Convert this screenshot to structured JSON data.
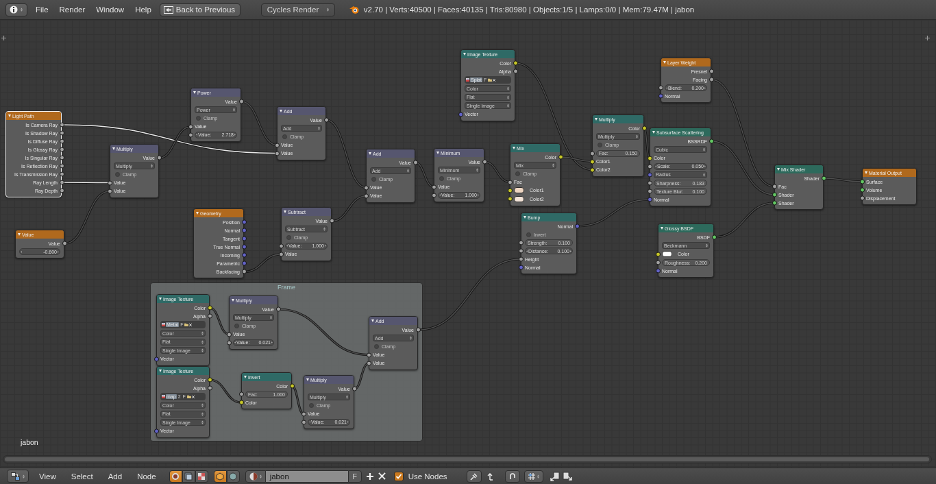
{
  "top_bar": {
    "menus": [
      "File",
      "Render",
      "Window",
      "Help"
    ],
    "back_button": "Back to Previous",
    "render_engine": "Cycles Render",
    "stats": "v2.70 | Verts:40500 | Faces:40135 | Tris:80980 | Objects:1/5 | Lamps:0/0 | Mem:79.47M | jabon"
  },
  "nodes": [
    {
      "title": "Light Path",
      "kind": "input",
      "selected": true,
      "rows": [
        {
          "kind": "output",
          "label": "Is Camera Ray",
          "socket": {
            "kind": "value"
          }
        },
        {
          "kind": "output",
          "label": "Is Shadow Ray",
          "socket": {
            "kind": "value"
          }
        },
        {
          "kind": "output",
          "label": "Is Diffuse Ray",
          "socket": {
            "kind": "value"
          }
        },
        {
          "kind": "output",
          "label": "Is Glossy Ray",
          "socket": {
            "kind": "value"
          }
        },
        {
          "kind": "output",
          "label": "Is Singular Ray",
          "socket": {
            "kind": "value"
          }
        },
        {
          "kind": "output",
          "label": "Is Reflection Ray",
          "socket": {
            "kind": "value"
          }
        },
        {
          "kind": "output",
          "label": "Is Transmission Ray",
          "socket": {
            "kind": "value"
          }
        },
        {
          "kind": "output",
          "label": "Ray Length",
          "socket": {
            "kind": "value"
          }
        },
        {
          "kind": "output",
          "label": "Ray Depth",
          "socket": {
            "kind": "value"
          }
        }
      ]
    },
    {
      "title": "Value",
      "kind": "input",
      "selected": false,
      "rows": [
        {
          "kind": "output",
          "label": "Value",
          "socket": {
            "kind": "value"
          }
        },
        {
          "kind": "number",
          "value": "-0.600"
        }
      ]
    },
    {
      "title": "Multiply",
      "kind": "converter",
      "selected": false,
      "rows": [
        {
          "kind": "output",
          "label": "Value",
          "socket": {
            "kind": "value"
          }
        },
        {
          "kind": "dropdown",
          "value": "Multiply"
        },
        {
          "kind": "checkbox",
          "label": "Clamp",
          "checked": false
        },
        {
          "kind": "input",
          "label": "Value",
          "socket": {
            "kind": "value"
          }
        },
        {
          "kind": "input",
          "label": "Value",
          "socket": {
            "kind": "value"
          }
        }
      ]
    },
    {
      "title": "Power",
      "kind": "converter",
      "selected": false,
      "rows": [
        {
          "kind": "output",
          "label": "Value",
          "socket": {
            "kind": "value"
          }
        },
        {
          "kind": "dropdown",
          "value": "Power"
        },
        {
          "kind": "checkbox",
          "label": "Clamp",
          "checked": false
        },
        {
          "kind": "input",
          "label": "Value",
          "socket": {
            "kind": "value"
          }
        },
        {
          "kind": "number",
          "label": "Value:",
          "value": "2.718",
          "socket": {
            "kind": "value"
          }
        }
      ]
    },
    {
      "title": "Add",
      "kind": "converter",
      "selected": false,
      "rows": [
        {
          "kind": "output",
          "label": "Value",
          "socket": {
            "kind": "value"
          }
        },
        {
          "kind": "dropdown",
          "value": "Add"
        },
        {
          "kind": "checkbox",
          "label": "Clamp",
          "checked": false
        },
        {
          "kind": "input",
          "label": "Value",
          "socket": {
            "kind": "value"
          }
        },
        {
          "kind": "input",
          "label": "Value",
          "socket": {
            "kind": "value"
          }
        }
      ]
    },
    {
      "title": "Geometry",
      "kind": "input",
      "selected": false,
      "rows": [
        {
          "kind": "output",
          "label": "Position",
          "socket": {
            "kind": "vector"
          }
        },
        {
          "kind": "output",
          "label": "Normal",
          "socket": {
            "kind": "vector"
          }
        },
        {
          "kind": "output",
          "label": "Tangent",
          "socket": {
            "kind": "vector"
          }
        },
        {
          "kind": "output",
          "label": "True Normal",
          "socket": {
            "kind": "vector"
          }
        },
        {
          "kind": "output",
          "label": "Incoming",
          "socket": {
            "kind": "vector"
          }
        },
        {
          "kind": "output",
          "label": "Parametric",
          "socket": {
            "kind": "vector"
          }
        },
        {
          "kind": "output",
          "label": "Backfacing",
          "socket": {
            "kind": "value"
          }
        }
      ]
    },
    {
      "title": "Subtract",
      "kind": "converter",
      "selected": false,
      "rows": [
        {
          "kind": "output",
          "label": "Value",
          "socket": {
            "kind": "value"
          }
        },
        {
          "kind": "dropdown",
          "value": "Subtract"
        },
        {
          "kind": "checkbox",
          "label": "Clamp",
          "checked": false
        },
        {
          "kind": "number",
          "label": "Value:",
          "value": "1.000",
          "socket": {
            "kind": "value"
          }
        },
        {
          "kind": "input",
          "label": "Value",
          "socket": {
            "kind": "value"
          }
        }
      ]
    },
    {
      "title": "Add",
      "kind": "converter",
      "selected": false,
      "rows": [
        {
          "kind": "output",
          "label": "Value",
          "socket": {
            "kind": "value"
          }
        },
        {
          "kind": "dropdown",
          "value": "Add"
        },
        {
          "kind": "checkbox",
          "label": "Clamp",
          "checked": false
        },
        {
          "kind": "input",
          "label": "Value",
          "socket": {
            "kind": "value"
          }
        },
        {
          "kind": "input",
          "label": "Value",
          "socket": {
            "kind": "value"
          }
        }
      ]
    },
    {
      "title": "Minimum",
      "kind": "converter",
      "selected": false,
      "rows": [
        {
          "kind": "output",
          "label": "Value",
          "socket": {
            "kind": "value"
          }
        },
        {
          "kind": "dropdown",
          "value": "Minimum"
        },
        {
          "kind": "checkbox",
          "label": "Clamp",
          "checked": false
        },
        {
          "kind": "input",
          "label": "Value",
          "socket": {
            "kind": "value"
          }
        },
        {
          "kind": "number",
          "label": "Value:",
          "value": "1.000",
          "socket": {
            "kind": "value"
          }
        }
      ]
    },
    {
      "title": "Mix",
      "kind": "color",
      "selected": false,
      "rows": [
        {
          "kind": "output",
          "label": "Color",
          "socket": {
            "kind": "color"
          }
        },
        {
          "kind": "dropdown",
          "value": "Mix"
        },
        {
          "kind": "checkbox",
          "label": "Clamp",
          "checked": false
        },
        {
          "kind": "input",
          "label": "Fac",
          "socket": {
            "kind": "value"
          }
        },
        {
          "kind": "color",
          "label": "Color1",
          "socket": {
            "kind": "color"
          },
          "color": "#efd6c2"
        },
        {
          "kind": "color",
          "label": "Color2",
          "socket": {
            "kind": "color"
          },
          "color": "#f3e4d8"
        }
      ]
    },
    {
      "title": "Image Texture",
      "kind": "texture",
      "selected": false,
      "rows": [
        {
          "kind": "output",
          "label": "Color",
          "socket": {
            "kind": "color"
          }
        },
        {
          "kind": "output",
          "label": "Alpha",
          "socket": {
            "kind": "value"
          }
        },
        {
          "kind": "image",
          "name": "Splat",
          "extras": [
            "F"
          ]
        },
        {
          "kind": "dropdown",
          "value": "Color"
        },
        {
          "kind": "dropdown",
          "value": "Flat"
        },
        {
          "kind": "dropdown",
          "value": "Single Image"
        },
        {
          "kind": "input",
          "label": "Vector",
          "socket": {
            "kind": "vector"
          }
        }
      ]
    },
    {
      "title": "Bump",
      "kind": "vector",
      "selected": false,
      "rows": [
        {
          "kind": "output",
          "label": "Normal",
          "socket": {
            "kind": "vector"
          }
        },
        {
          "kind": "checkbox",
          "label": "Invert",
          "checked": false
        },
        {
          "kind": "slider",
          "label": "Strength:",
          "value": "0.100",
          "socket": {
            "kind": "value"
          }
        },
        {
          "kind": "number",
          "label": "Distance:",
          "value": "0.100",
          "socket": {
            "kind": "value"
          }
        },
        {
          "kind": "input",
          "label": "Height",
          "socket": {
            "kind": "value"
          }
        },
        {
          "kind": "input",
          "label": "Normal",
          "socket": {
            "kind": "vector"
          }
        }
      ]
    },
    {
      "title": "Multiply",
      "kind": "color",
      "selected": false,
      "rows": [
        {
          "kind": "output",
          "label": "Color",
          "socket": {
            "kind": "color"
          }
        },
        {
          "kind": "dropdown",
          "value": "Multiply"
        },
        {
          "kind": "checkbox",
          "label": "Clamp",
          "checked": false
        },
        {
          "kind": "slider",
          "label": "Fac:",
          "value": "0.150",
          "socket": {
            "kind": "value"
          }
        },
        {
          "kind": "input",
          "label": "Color1",
          "socket": {
            "kind": "color"
          }
        },
        {
          "kind": "input",
          "label": "Color2",
          "socket": {
            "kind": "color"
          }
        }
      ]
    },
    {
      "title": "Layer Weight",
      "kind": "input",
      "selected": false,
      "rows": [
        {
          "kind": "output",
          "label": "Fresnel",
          "socket": {
            "kind": "value"
          }
        },
        {
          "kind": "output",
          "label": "Facing",
          "socket": {
            "kind": "value"
          }
        },
        {
          "kind": "number",
          "label": "Blend:",
          "value": "0.200",
          "socket": {
            "kind": "value"
          }
        },
        {
          "kind": "input",
          "label": "Normal",
          "socket": {
            "kind": "vector"
          }
        }
      ]
    },
    {
      "title": "Subsurface Scattering",
      "kind": "shader",
      "selected": false,
      "rows": [
        {
          "kind": "output",
          "label": "BSSRDF",
          "socket": {
            "kind": "shader"
          }
        },
        {
          "kind": "dropdown",
          "value": "Cubic"
        },
        {
          "kind": "input",
          "label": "Color",
          "socket": {
            "kind": "color"
          }
        },
        {
          "kind": "number",
          "label": "Scale:",
          "value": "0.050",
          "socket": {
            "kind": "value"
          }
        },
        {
          "kind": "dropdown",
          "value": "Radius",
          "socket": {
            "kind": "vector"
          }
        },
        {
          "kind": "slider",
          "label": "Sharpness:",
          "value": "0.183",
          "socket": {
            "kind": "value"
          }
        },
        {
          "kind": "slider",
          "label": "Texture Blur:",
          "value": "0.100",
          "socket": {
            "kind": "value"
          }
        },
        {
          "kind": "input",
          "label": "Normal",
          "socket": {
            "kind": "vector"
          }
        }
      ]
    },
    {
      "title": "Glossy BSDF",
      "kind": "shader",
      "selected": false,
      "rows": [
        {
          "kind": "output",
          "label": "BSDF",
          "socket": {
            "kind": "shader"
          }
        },
        {
          "kind": "dropdown",
          "value": "Beckmann"
        },
        {
          "kind": "color",
          "label": "Color",
          "socket": {
            "kind": "color"
          },
          "color": "#ffffff"
        },
        {
          "kind": "slider",
          "label": "Roughness:",
          "value": "0.200",
          "socket": {
            "kind": "value"
          }
        },
        {
          "kind": "input",
          "label": "Normal",
          "socket": {
            "kind": "vector"
          }
        }
      ]
    },
    {
      "title": "Mix Shader",
      "kind": "shader",
      "selected": false,
      "rows": [
        {
          "kind": "output",
          "label": "Shader",
          "socket": {
            "kind": "shader"
          }
        },
        {
          "kind": "input",
          "label": "Fac",
          "socket": {
            "kind": "value"
          }
        },
        {
          "kind": "input",
          "label": "Shader",
          "socket": {
            "kind": "shader"
          }
        },
        {
          "kind": "input",
          "label": "Shader",
          "socket": {
            "kind": "shader"
          }
        }
      ]
    },
    {
      "title": "Material Output",
      "kind": "output",
      "selected": false,
      "rows": [
        {
          "kind": "input",
          "label": "Surface",
          "socket": {
            "kind": "shader"
          }
        },
        {
          "kind": "input",
          "label": "Volume",
          "socket": {
            "kind": "shader"
          }
        },
        {
          "kind": "input",
          "label": "Displacement",
          "socket": {
            "kind": "value"
          }
        }
      ]
    }
  ],
  "frame": {
    "label": "Frame",
    "nodes": [
      {
        "title": "Image Texture",
        "kind": "texture",
        "selected": false,
        "rows": [
          {
            "kind": "output",
            "label": "Color",
            "socket": {
              "kind": "color"
            }
          },
          {
            "kind": "output",
            "label": "Alpha",
            "socket": {
              "kind": "value"
            }
          },
          {
            "kind": "image",
            "name": "Metal",
            "extras": [
              "F"
            ]
          },
          {
            "kind": "dropdown",
            "value": "Color"
          },
          {
            "kind": "dropdown",
            "value": "Flat"
          },
          {
            "kind": "dropdown",
            "value": "Single Image"
          },
          {
            "kind": "input",
            "label": "Vector",
            "socket": {
              "kind": "vector"
            }
          }
        ]
      },
      {
        "title": "Multiply",
        "kind": "converter",
        "selected": false,
        "rows": [
          {
            "kind": "output",
            "label": "Value",
            "socket": {
              "kind": "value"
            }
          },
          {
            "kind": "dropdown",
            "value": "Multiply"
          },
          {
            "kind": "checkbox",
            "label": "Clamp",
            "checked": false
          },
          {
            "kind": "input",
            "label": "Value",
            "socket": {
              "kind": "value"
            }
          },
          {
            "kind": "number",
            "label": "Value:",
            "value": "0.021",
            "socket": {
              "kind": "value"
            }
          }
        ]
      },
      {
        "title": "Add",
        "kind": "converter",
        "selected": false,
        "rows": [
          {
            "kind": "output",
            "label": "Value",
            "socket": {
              "kind": "value"
            }
          },
          {
            "kind": "dropdown",
            "value": "Add"
          },
          {
            "kind": "checkbox",
            "label": "Clamp",
            "checked": false
          },
          {
            "kind": "input",
            "label": "Value",
            "socket": {
              "kind": "value"
            }
          },
          {
            "kind": "input",
            "label": "Value",
            "socket": {
              "kind": "value"
            }
          }
        ]
      },
      {
        "title": "Image Texture",
        "kind": "texture",
        "selected": false,
        "rows": [
          {
            "kind": "output",
            "label": "Color",
            "socket": {
              "kind": "color"
            }
          },
          {
            "kind": "output",
            "label": "Alpha",
            "socket": {
              "kind": "value"
            }
          },
          {
            "kind": "image",
            "name": "map",
            "extras": [
              "2",
              "F"
            ]
          },
          {
            "kind": "dropdown",
            "value": "Color"
          },
          {
            "kind": "dropdown",
            "value": "Flat"
          },
          {
            "kind": "dropdown",
            "value": "Single Image"
          },
          {
            "kind": "input",
            "label": "Vector",
            "socket": {
              "kind": "vector"
            }
          }
        ]
      },
      {
        "title": "Invert",
        "kind": "color",
        "selected": false,
        "rows": [
          {
            "kind": "output",
            "label": "Color",
            "socket": {
              "kind": "color"
            }
          },
          {
            "kind": "slider",
            "label": "Fac:",
            "value": "1.000",
            "socket": {
              "kind": "value"
            }
          },
          {
            "kind": "input",
            "label": "Color",
            "socket": {
              "kind": "color"
            }
          }
        ]
      },
      {
        "title": "Multiply",
        "kind": "converter",
        "selected": false,
        "rows": [
          {
            "kind": "output",
            "label": "Value",
            "socket": {
              "kind": "value"
            }
          },
          {
            "kind": "dropdown",
            "value": "Multiply"
          },
          {
            "kind": "checkbox",
            "label": "Clamp",
            "checked": false
          },
          {
            "kind": "input",
            "label": "Value",
            "socket": {
              "kind": "value"
            }
          },
          {
            "kind": "number",
            "label": "Value:",
            "value": "0.021",
            "socket": {
              "kind": "value"
            }
          }
        ]
      }
    ]
  },
  "material_label": "jabon",
  "bottom_bar": {
    "menus": [
      "View",
      "Select",
      "Add",
      "Node"
    ],
    "shader_types": [
      {
        "selected": true
      },
      {
        "selected": false
      },
      {
        "selected": false
      }
    ],
    "shader_owners": [
      {
        "selected": true
      },
      {
        "selected": false
      }
    ],
    "material": {
      "name": "jabon",
      "fake_user": "F"
    },
    "use_nodes": {
      "label": "Use Nodes",
      "checked": true
    }
  }
}
